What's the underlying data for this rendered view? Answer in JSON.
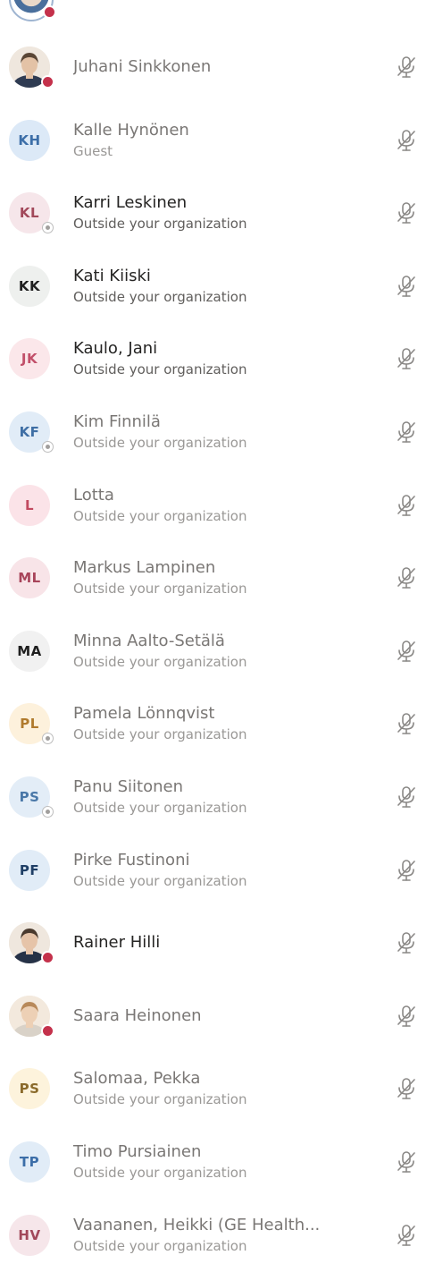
{
  "colors": {
    "status_busy": "#c4314b",
    "mic_muted": "#8a8886",
    "text_primary": "#252423",
    "text_secondary": "#605e5c"
  },
  "participants": [
    {
      "name": "Juhani Sinkkonen",
      "subtitle": "",
      "avatar": "photo",
      "initials": "",
      "avatar_bg": "#efe7de",
      "avatar_fg": "#252423",
      "status": "busy",
      "mic": "mic-off-icon"
    },
    {
      "name": "Kalle Hynönen",
      "subtitle": "Guest",
      "avatar": "initials",
      "initials": "KH",
      "avatar_bg": "#dce9f7",
      "avatar_fg": "#3c6ea8",
      "status": "none",
      "mic": "mic-off-icon"
    },
    {
      "name": "Karri Leskinen",
      "subtitle": "Outside your organization",
      "avatar": "initials",
      "initials": "KL",
      "avatar_bg": "#f6e6ea",
      "avatar_fg": "#a2485a",
      "status": "guest",
      "mic": "mic-off-icon"
    },
    {
      "name": "Kati Kiiski",
      "subtitle": "Outside your organization",
      "avatar": "initials",
      "initials": "KK",
      "avatar_bg": "#eef0ee",
      "avatar_fg": "#1f1f1f",
      "status": "none",
      "mic": "mic-off-icon"
    },
    {
      "name": "Kaulo, Jani",
      "subtitle": "Outside your organization",
      "avatar": "initials",
      "initials": "JK",
      "avatar_bg": "#fbe7ea",
      "avatar_fg": "#c2506a",
      "status": "none",
      "mic": "mic-off-icon"
    },
    {
      "name": "Kim Finnilä",
      "subtitle": "Outside your organization",
      "avatar": "initials",
      "initials": "KF",
      "avatar_bg": "#e1ecf7",
      "avatar_fg": "#3f6fa5",
      "status": "guest",
      "mic": "mic-off-icon"
    },
    {
      "name": "Lotta",
      "subtitle": "Outside your organization",
      "avatar": "initials",
      "initials": "L",
      "avatar_bg": "#fbe3e8",
      "avatar_fg": "#c24a60",
      "status": "none",
      "mic": "mic-off-icon"
    },
    {
      "name": "Markus Lampinen",
      "subtitle": "Outside your organization",
      "avatar": "initials",
      "initials": "ML",
      "avatar_bg": "#f8e4e8",
      "avatar_fg": "#a8445a",
      "status": "none",
      "mic": "mic-off-icon"
    },
    {
      "name": "Minna Aalto-Setälä",
      "subtitle": "Outside your organization",
      "avatar": "initials",
      "initials": "MA",
      "avatar_bg": "#f1f1f1",
      "avatar_fg": "#1f1f1f",
      "status": "none",
      "mic": "mic-off-icon"
    },
    {
      "name": "Pamela Lönnqvist",
      "subtitle": "Outside your organization",
      "avatar": "initials",
      "initials": "PL",
      "avatar_bg": "#fdf1dc",
      "avatar_fg": "#b07a2c",
      "status": "guest",
      "mic": "mic-off-icon"
    },
    {
      "name": "Panu Siitonen",
      "subtitle": "Outside your organization",
      "avatar": "initials",
      "initials": "PS",
      "avatar_bg": "#e3edf7",
      "avatar_fg": "#4a78a8",
      "status": "guest",
      "mic": "mic-off-icon"
    },
    {
      "name": "Pirke Fustinoni",
      "subtitle": "Outside your organization",
      "avatar": "initials",
      "initials": "PF",
      "avatar_bg": "#e1ecf7",
      "avatar_fg": "#1f3f66",
      "status": "none",
      "mic": "mic-off-icon"
    },
    {
      "name": "Rainer Hilli",
      "subtitle": "",
      "avatar": "photo",
      "initials": "",
      "avatar_bg": "#efe7de",
      "avatar_fg": "#252423",
      "status": "busy",
      "mic": "mic-off-icon"
    },
    {
      "name": "Saara Heinonen",
      "subtitle": "",
      "avatar": "photo",
      "initials": "",
      "avatar_bg": "#f3e9dd",
      "avatar_fg": "#252423",
      "status": "busy",
      "mic": "mic-off-icon"
    },
    {
      "name": "Salomaa, Pekka",
      "subtitle": "Outside your organization",
      "avatar": "initials",
      "initials": "PS",
      "avatar_bg": "#fdf3dc",
      "avatar_fg": "#8a6a2a",
      "status": "none",
      "mic": "mic-off-icon"
    },
    {
      "name": "Timo Pursiainen",
      "subtitle": "Outside your organization",
      "avatar": "initials",
      "initials": "TP",
      "avatar_bg": "#e1ecf7",
      "avatar_fg": "#3c6ea8",
      "status": "none",
      "mic": "mic-off-icon"
    },
    {
      "name": "Vaananen, Heikki (GE Health...",
      "subtitle": "Outside your organization",
      "avatar": "initials",
      "initials": "HV",
      "avatar_bg": "#f6e6ea",
      "avatar_fg": "#a2485a",
      "status": "none",
      "mic": "mic-off-icon"
    }
  ]
}
